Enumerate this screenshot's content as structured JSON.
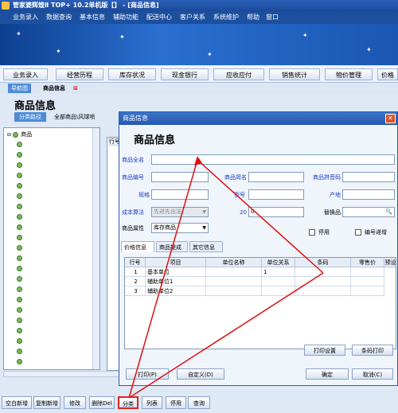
{
  "app": {
    "title": "管家婆辉煌Ⅱ TOP+ 10.2单机版【】 - [商品信息]"
  },
  "menu": [
    "业务录入",
    "数据查询",
    "基本信息",
    "辅助功能",
    "配送中心",
    "客户关系",
    "系统维护",
    "帮助",
    "窗口"
  ],
  "nav": [
    "业务录入",
    "经营历程",
    "库存状况",
    "现金银行",
    "应收应付",
    "销售统计",
    "物价管理",
    "价格"
  ],
  "tabs": {
    "home": "导航图",
    "active": "商品信息"
  },
  "page": {
    "title": "商品信息",
    "crumb_button": "分类路径",
    "crumb_path": "全部商品\\风球喷"
  },
  "tree": {
    "root": "商品"
  },
  "grid_col": "行号",
  "bottom_buttons": [
    "空白新增",
    "复制新增",
    "修改",
    "删除Del",
    "分类",
    "列表",
    "停用",
    "查询"
  ],
  "dialog": {
    "title": "商品信息",
    "heading": "商品信息",
    "labels": {
      "full_name": "商品全名",
      "code": "商品编号",
      "short_name": "商品简名",
      "pinyin": "商品拼音码",
      "spec": "规格",
      "model": "型号",
      "origin": "产地",
      "cost_method": "成本算法",
      "attr": "商品属性",
      "substitute": "替换品",
      "disable": "停用",
      "auto_code": "编号递增"
    },
    "values": {
      "cost_method": "先进先出法",
      "field20": "20",
      "field20_value": "0",
      "attr": "库存商品"
    },
    "tabs": [
      "价格信息",
      "商品提成",
      "其它信息"
    ],
    "table": {
      "headers": [
        "行号",
        "项目",
        "单位名称",
        "单位关系",
        "条码",
        "零售价",
        "预设"
      ],
      "rows": [
        {
          "no": "1",
          "item": "基本单位",
          "unit": "",
          "rel": "1"
        },
        {
          "no": "2",
          "item": "辅助单位1",
          "unit": "",
          "rel": ""
        },
        {
          "no": "3",
          "item": "辅助单位2",
          "unit": "",
          "rel": ""
        }
      ]
    },
    "buttons": {
      "print_setup": "打印设置",
      "barcode_print": "条码打印",
      "print": "打印(P)",
      "custom": "自定义(D)",
      "ok": "确定",
      "cancel": "取消(C)"
    }
  }
}
